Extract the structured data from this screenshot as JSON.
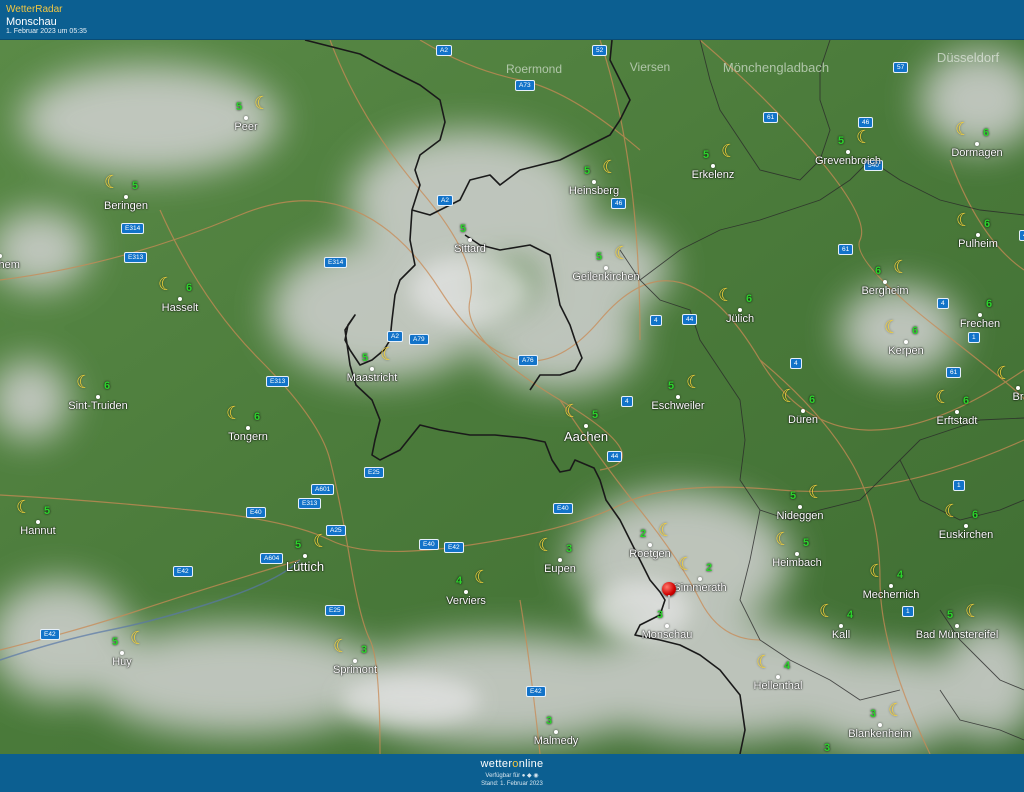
{
  "header": {
    "brand": "WetterRadar",
    "place": "Monschau",
    "timestamp": "1. Februar 2023 um 05:35"
  },
  "footer": {
    "logo_left": "wetter",
    "logo_o": "o",
    "logo_right": "nline",
    "availability": "Verfügbar für  ● ◆ ◉",
    "stand": "Stand: 1. Februar 2023"
  },
  "icon": "crescent-moon-icon",
  "colors": {
    "temp": "#2cd32c",
    "moon": "#f6d23a",
    "land": "#4f7f3f",
    "cloud": "#c8c8c8",
    "header": "#0c5f91"
  },
  "cities": [
    {
      "name": "Peer",
      "temp": "5",
      "moon": true
    },
    {
      "name": "Beringen",
      "temp": "5",
      "moon": true
    },
    {
      "name": "-Zichem",
      "temp": "",
      "moon": false
    },
    {
      "name": "Hasselt",
      "temp": "6",
      "moon": true
    },
    {
      "name": "Sint-Truiden",
      "temp": "6",
      "moon": true
    },
    {
      "name": "Tongern",
      "temp": "6",
      "moon": true
    },
    {
      "name": "Hannut",
      "temp": "5",
      "moon": true
    },
    {
      "name": "Lüttich",
      "temp": "5",
      "moon": true
    },
    {
      "name": "Huy",
      "temp": "5",
      "moon": true
    },
    {
      "name": "Sprimont",
      "temp": "3",
      "moon": true
    },
    {
      "name": "Verviers",
      "temp": "4",
      "moon": true
    },
    {
      "name": "Maastricht",
      "temp": "5",
      "moon": true
    },
    {
      "name": "Sittard",
      "temp": "5",
      "moon": false
    },
    {
      "name": "Heinsberg",
      "temp": "5",
      "moon": true
    },
    {
      "name": "Geilenkirchen",
      "temp": "5",
      "moon": true
    },
    {
      "name": "Erkelenz",
      "temp": "5",
      "moon": true
    },
    {
      "name": "Aachen",
      "temp": "5",
      "moon": true
    },
    {
      "name": "Eupen",
      "temp": "3",
      "moon": true
    },
    {
      "name": "Roetgen",
      "temp": "2",
      "moon": true
    },
    {
      "name": "Simmerath",
      "temp": "2",
      "moon": true
    },
    {
      "name": "Monschau",
      "temp": "3",
      "moon": false
    },
    {
      "name": "Malmedy",
      "temp": "3",
      "moon": false
    },
    {
      "name": "Eschweiler",
      "temp": "5",
      "moon": true
    },
    {
      "name": "Jülich",
      "temp": "6",
      "moon": true
    },
    {
      "name": "Düren",
      "temp": "6",
      "moon": true
    },
    {
      "name": "Nideggen",
      "temp": "5",
      "moon": true
    },
    {
      "name": "Heimbach",
      "temp": "5",
      "moon": true
    },
    {
      "name": "Hellenthal",
      "temp": "4",
      "moon": true
    },
    {
      "name": "Grevenbroich",
      "temp": "5",
      "moon": true
    },
    {
      "name": "Dormagen",
      "temp": "6",
      "moon": true
    },
    {
      "name": "Bergheim",
      "temp": "6",
      "moon": true
    },
    {
      "name": "Pulheim",
      "temp": "6",
      "moon": true
    },
    {
      "name": "Frechen",
      "temp": "6",
      "moon": false
    },
    {
      "name": "Kerpen",
      "temp": "6",
      "moon": true
    },
    {
      "name": "Erftstadt",
      "temp": "6",
      "moon": true
    },
    {
      "name": "Euskirchen",
      "temp": "6",
      "moon": true
    },
    {
      "name": "Mechernich",
      "temp": "4",
      "moon": true
    },
    {
      "name": "Kall",
      "temp": "4",
      "moon": true
    },
    {
      "name": "Bad Münstereifel",
      "temp": "5",
      "moon": true
    },
    {
      "name": "Blankenheim",
      "temp": "3",
      "moon": true
    },
    {
      "name": "Br",
      "temp": "",
      "moon": true
    }
  ],
  "ghost_labels": [
    "Roermond",
    "Mönchengladbach",
    "Düsseldorf",
    "Viersen"
  ],
  "roads": [
    "A2",
    "A73",
    "52",
    "57",
    "61",
    "46",
    "540",
    "A2",
    "46",
    "E314",
    "E313",
    "E314",
    "61",
    "4",
    "4",
    "44",
    "A2",
    "A79",
    "A76",
    "1",
    "61",
    "E313",
    "4",
    "44",
    "E25",
    "A601",
    "E313",
    "E40",
    "A25",
    "A604",
    "E40",
    "E42",
    "E40",
    "E42",
    "E25",
    "E42",
    "1",
    "E42",
    "4",
    "1",
    "4"
  ],
  "extra_temps": [
    "3"
  ]
}
